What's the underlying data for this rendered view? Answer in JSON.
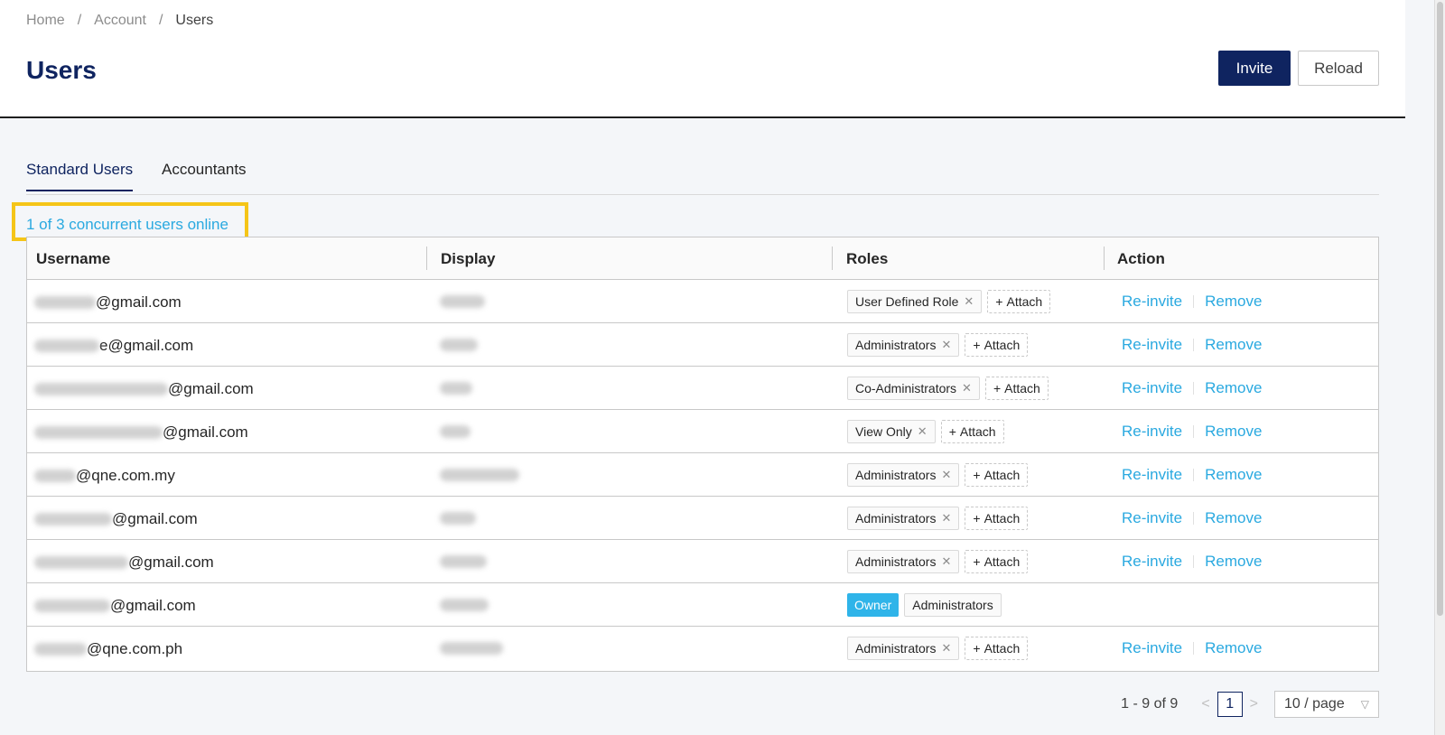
{
  "breadcrumb": {
    "items": [
      "Home",
      "Account",
      "Users"
    ],
    "separator": "/"
  },
  "page_title": "Users",
  "buttons": {
    "invite": "Invite",
    "reload": "Reload"
  },
  "tabs": [
    {
      "label": "Standard Users",
      "active": true
    },
    {
      "label": "Accountants",
      "active": false
    }
  ],
  "online_status": "1 of 3 concurrent users online",
  "table": {
    "headers": {
      "username": "Username",
      "display": "Display",
      "roles": "Roles",
      "action": "Action"
    },
    "attach_label": "Attach",
    "reinvite_label": "Re-invite",
    "remove_label": "Remove",
    "rows": [
      {
        "email_domain": "@gmail.com",
        "roles": [
          "User Defined Role"
        ],
        "owner": false
      },
      {
        "email_domain": "e@gmail.com",
        "roles": [
          "Administrators"
        ],
        "owner": false
      },
      {
        "email_domain": "@gmail.com",
        "roles": [
          "Co-Administrators"
        ],
        "owner": false
      },
      {
        "email_domain": "@gmail.com",
        "roles": [
          "View Only"
        ],
        "owner": false
      },
      {
        "email_domain": "@qne.com.my",
        "roles": [
          "Administrators"
        ],
        "owner": false
      },
      {
        "email_domain": "@gmail.com",
        "roles": [
          "Administrators"
        ],
        "owner": false
      },
      {
        "email_domain": "@gmail.com",
        "roles": [
          "Administrators"
        ],
        "owner": false
      },
      {
        "email_domain": "@gmail.com",
        "owner_label": "Owner",
        "roles": [
          "Administrators"
        ],
        "owner": true
      },
      {
        "email_domain": "@qne.com.ph",
        "roles": [
          "Administrators"
        ],
        "owner": false
      }
    ]
  },
  "pagination": {
    "range": "1 - 9 of 9",
    "current_page": "1",
    "page_size": "10 / page"
  },
  "colors": {
    "primary": "#0f2460",
    "link": "#2aa9e0",
    "highlight": "#f5c518",
    "owner": "#2fb4e9"
  }
}
